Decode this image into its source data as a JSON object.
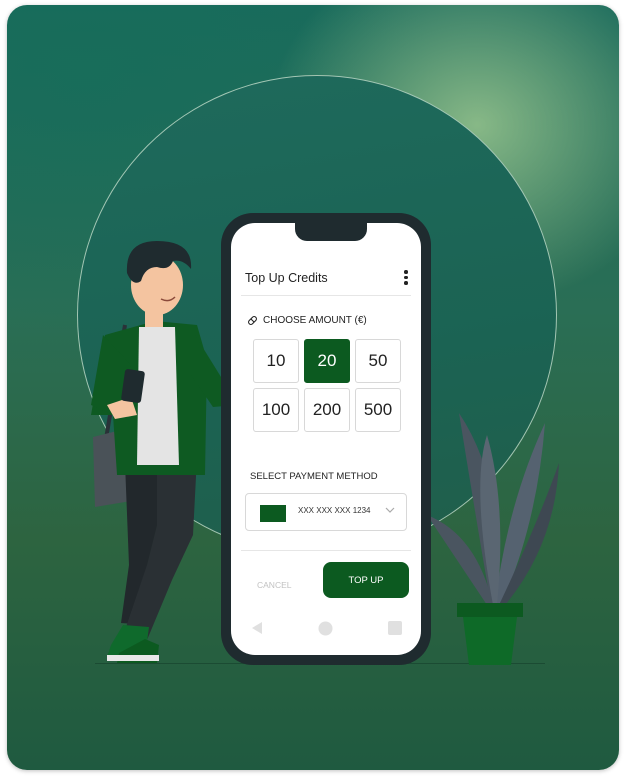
{
  "screen": {
    "title": "Top Up Credits",
    "menu_icon": "kebab-menu-icon"
  },
  "amount": {
    "label": "CHOOSE AMOUNT (€)",
    "icon": "pill-icon",
    "options": [
      "10",
      "20",
      "50",
      "100",
      "200",
      "500"
    ],
    "selected": "20"
  },
  "payment": {
    "label": "SELECT PAYMENT METHOD",
    "card_number": "XXX XXX XXX 1234",
    "dropdown_icon": "chevron-down-icon"
  },
  "actions": {
    "cancel_label": "CANCEL",
    "topup_label": "TOP UP"
  },
  "nav": {
    "back_icon": "back-triangle-icon",
    "home_icon": "home-circle-icon",
    "recent_icon": "recent-square-icon"
  },
  "colors": {
    "accent": "#0c5a20",
    "phone_frame": "#1f2b2f",
    "background": "#1b6353"
  }
}
